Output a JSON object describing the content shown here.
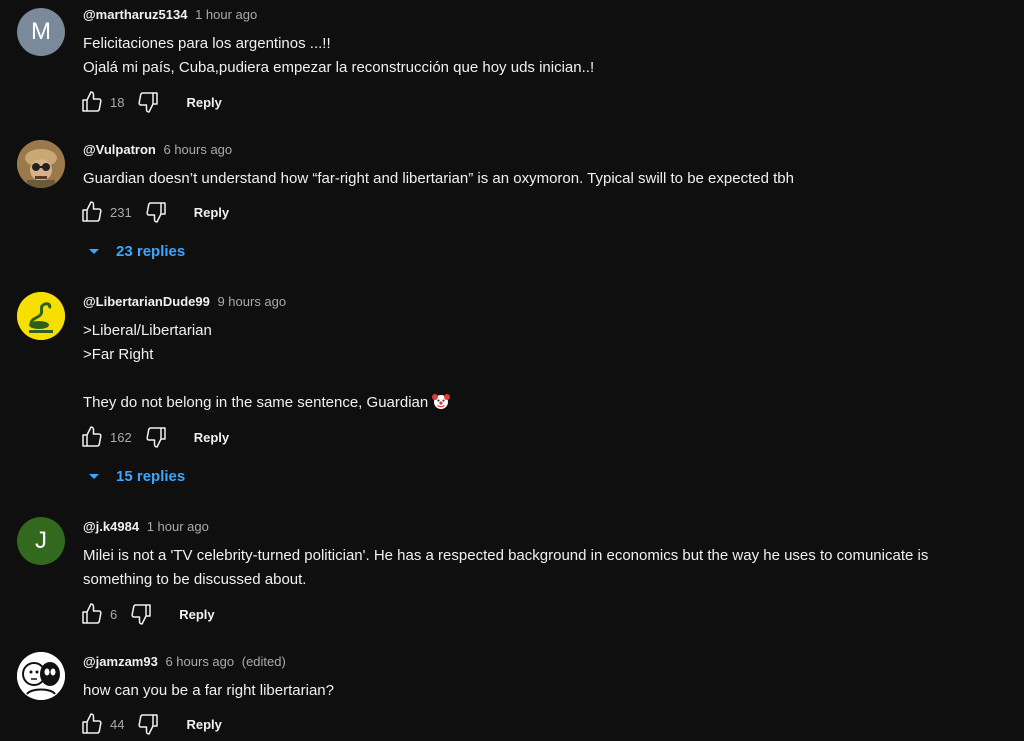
{
  "comments": [
    {
      "author": "@martharuz5134",
      "time": "1 hour ago",
      "avatar_letter": "M",
      "avatar_color": "#7b8a9a",
      "lines": [
        "Felicitaciones para los argentinos ...!!",
        "Ojalá mi país, Cuba,pudiera empezar la reconstrucción que hoy uds inician..!"
      ],
      "likes": "18",
      "reply_label": "Reply"
    },
    {
      "author": "@Vulpatron",
      "time": "6 hours ago",
      "avatar_icon": "person-with-goggles-avatar",
      "lines": [
        "Guardian doesn’t understand how “far-right and libertarian” is an oxymoron. Typical swill to be expected tbh"
      ],
      "likes": "231",
      "reply_label": "Reply",
      "replies_label": "23 replies"
    },
    {
      "author": "@LibertarianDude99",
      "time": "9 hours ago",
      "avatar_icon": "gadsden-snake-avatar",
      "avatar_color": "#f7e000",
      "lines": [
        ">Liberal/Libertarian",
        ">Far Right",
        "",
        "They do not belong in the same sentence, Guardian"
      ],
      "emoji": "clown-face-emoji",
      "likes": "162",
      "reply_label": "Reply",
      "replies_label": "15 replies"
    },
    {
      "author": "@j.k4984",
      "time": "1 hour ago",
      "avatar_letter": "J",
      "avatar_color": "#33691e",
      "lines": [
        "Milei is not a 'TV celebrity-turned politician'. He has a respected background in economics but the way he uses to comunicate is",
        "something to be discussed about."
      ],
      "likes": "6",
      "reply_label": "Reply"
    },
    {
      "author": "@jamzam93",
      "time": "6 hours ago",
      "edited": "(edited)",
      "avatar_icon": "cartoon-faces-avatar",
      "lines": [
        "how can you be a far right libertarian?"
      ],
      "likes": "44",
      "reply_label": "Reply"
    }
  ],
  "colors": {
    "background": "#0f0f0f",
    "text": "#f1f1f1",
    "secondary_text": "#aaaaaa",
    "link_blue": "#3ea6ff"
  }
}
